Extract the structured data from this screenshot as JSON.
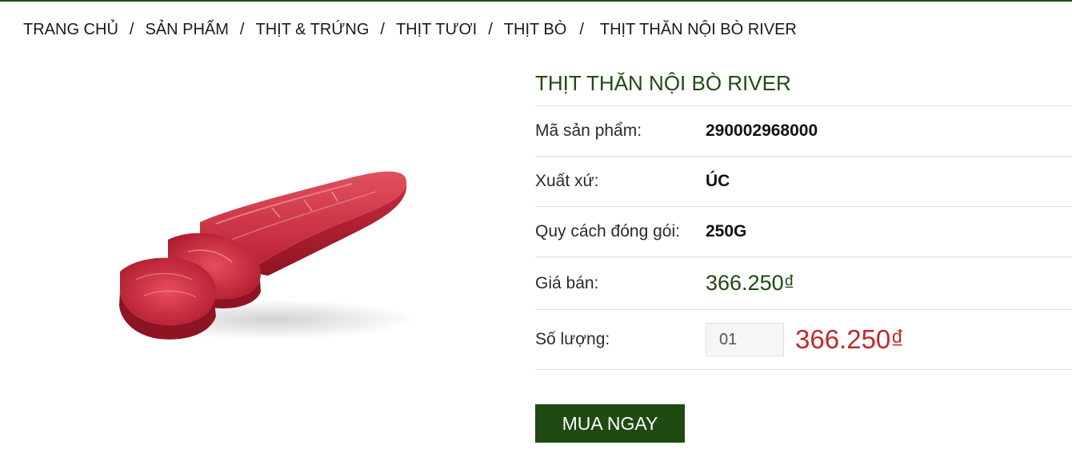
{
  "breadcrumb": {
    "items": [
      "TRANG CHỦ",
      "SẢN PHẨM",
      "THỊT & TRỨNG",
      "THỊT TƯƠI",
      "THỊT BÒ"
    ],
    "separator": "/",
    "current": "THỊT THĂN NỘI BÒ RIVER"
  },
  "product": {
    "title": "THỊT THĂN NỘI BÒ RIVER",
    "sku_label": "Mã sản phẩm:",
    "sku_value": "290002968000",
    "origin_label": "Xuất xứ:",
    "origin_value": "ÚC",
    "pack_label": "Quy cách đóng gói:",
    "pack_value": "250G",
    "price_label": "Giá bán:",
    "price_value": "366.250₫",
    "qty_label": "Số lượng:",
    "qty_value": "01",
    "total_value": "366.250₫",
    "buy_label": "MUA NGAY",
    "image_alt": "beef-tenderloin-image"
  },
  "colors": {
    "brand_green": "#1f4a12",
    "total_red": "#c0292b"
  }
}
